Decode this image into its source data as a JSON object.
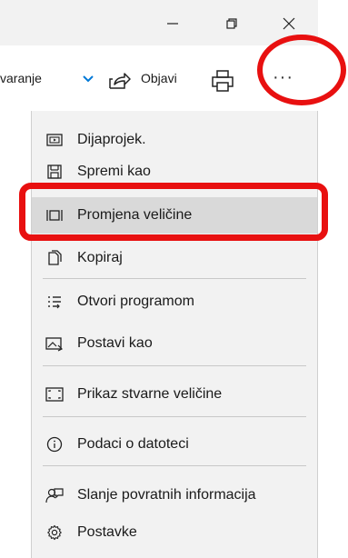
{
  "window": {
    "minimize_label": "Minimize",
    "restore_label": "Restore",
    "close_label": "Close"
  },
  "toolbar": {
    "enhance_label": "varanje",
    "share_label": "Objavi",
    "print_label": "",
    "more_label": "···"
  },
  "menu": {
    "items": [
      {
        "label": "Dijaprojek.",
        "icon": "slideshow-icon"
      },
      {
        "label": "Spremi kao",
        "icon": "save-icon"
      },
      {
        "label": "Promjena veličine",
        "icon": "resize-icon",
        "highlighted": true
      },
      {
        "label": "Kopiraj",
        "icon": "copy-icon"
      },
      {
        "label": "Otvori programom",
        "icon": "open-with-icon"
      },
      {
        "label": "Postavi kao",
        "icon": "set-as-icon"
      },
      {
        "label": "Prikaz stvarne veličine",
        "icon": "actual-size-icon"
      },
      {
        "label": "Podaci o datoteci",
        "icon": "info-icon"
      },
      {
        "label": "Slanje povratnih informacija",
        "icon": "feedback-icon"
      },
      {
        "label": "Postavke",
        "icon": "settings-icon"
      }
    ]
  },
  "colors": {
    "annotation": "#e81010",
    "highlight": "#d9d9d9",
    "menu_bg": "#f2f2f2",
    "accent": "#0078d7"
  }
}
